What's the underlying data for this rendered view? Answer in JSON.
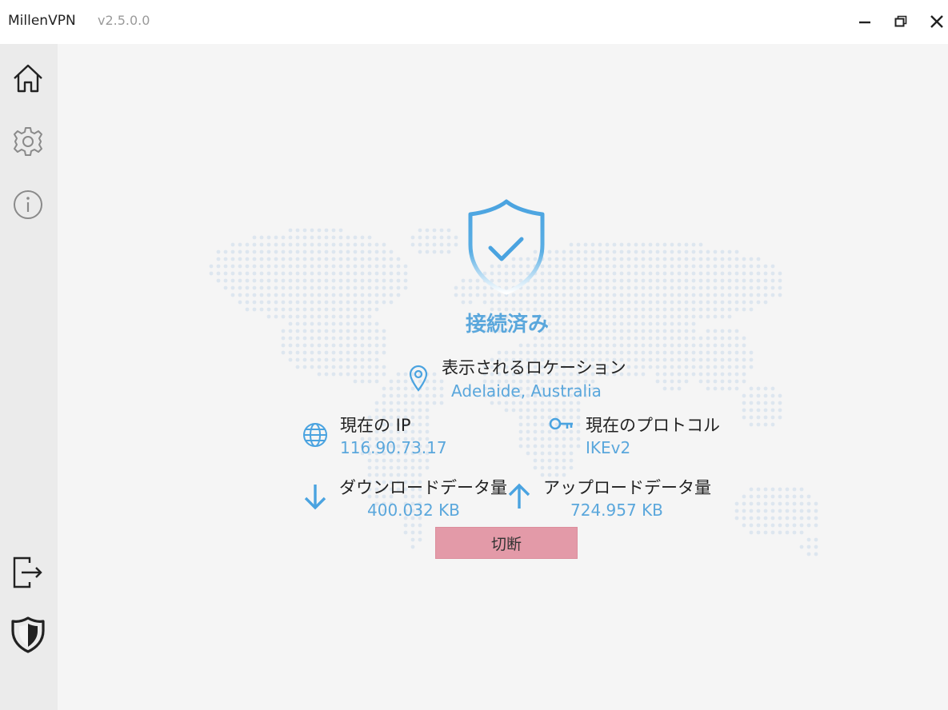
{
  "app": {
    "name": "MillenVPN",
    "version": "v2.5.0.0"
  },
  "window_controls": {
    "minimize": "minimize-icon",
    "maximize": "restore-icon",
    "close": "close-icon"
  },
  "sidebar": {
    "items": [
      {
        "id": "home",
        "icon": "home-icon"
      },
      {
        "id": "settings",
        "icon": "gear-icon"
      },
      {
        "id": "info",
        "icon": "info-icon"
      }
    ],
    "bottom_items": [
      {
        "id": "logout",
        "icon": "logout-icon"
      },
      {
        "id": "brand",
        "icon": "millenvpn-logo-icon"
      }
    ]
  },
  "status": {
    "text": "接続済み",
    "icon": "shield-check-icon"
  },
  "location": {
    "label": "表示されるロケーション",
    "value": "Adelaide, Australia",
    "icon": "location-pin-icon"
  },
  "ip": {
    "label": "現在の IP",
    "value": "116.90.73.17",
    "icon": "globe-icon"
  },
  "protocol": {
    "label": "現在のプロトコル",
    "value": "IKEv2",
    "icon": "key-icon"
  },
  "download": {
    "label": "ダウンロードデータ量",
    "value": "400.032 KB",
    "icon": "arrow-down-icon"
  },
  "upload": {
    "label": "アップロードデータ量",
    "value": "724.957 KB",
    "icon": "arrow-up-icon"
  },
  "disconnect": {
    "label": "切断"
  },
  "colors": {
    "accent": "#5aa7dc",
    "disconnect_bg": "#e39aa8",
    "sidebar_bg": "#ebebeb",
    "main_bg": "#f5f5f5"
  }
}
